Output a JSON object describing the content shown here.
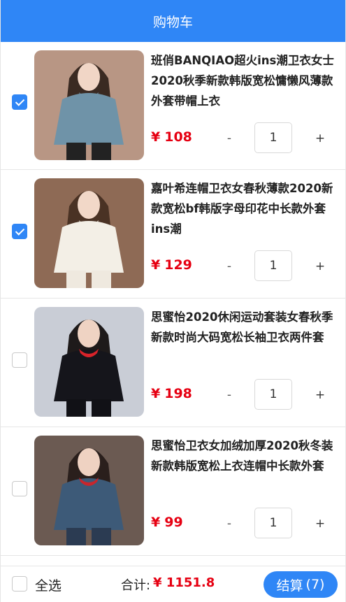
{
  "header": {
    "title": "购物车"
  },
  "currency_symbol": "¥",
  "items": [
    {
      "title": "班俏BANQIAO超火ins潮卫衣女士2020秋季新款韩版宽松慵懒风薄款外套带帽上衣",
      "price": "108",
      "qty": "1",
      "checked": true,
      "minus": "-",
      "plus": "+",
      "colors": {
        "bg": "#b89684",
        "cloth": "#6f93a8",
        "hair": "#3a2a22",
        "skin": "#f1d6c6",
        "pants": "#222222"
      }
    },
    {
      "title": "嘉叶希连帽卫衣女春秋薄款2020新款宽松bf韩版字母印花中长款外套ins潮",
      "price": "129",
      "qty": "1",
      "checked": true,
      "minus": "-",
      "plus": "+",
      "colors": {
        "bg": "#8e6a55",
        "cloth": "#f3efe6",
        "hair": "#4a3224",
        "skin": "#f2d8c8",
        "pants": "#efe9df"
      }
    },
    {
      "title": "思蜜怡2020休闲运动套装女春秋季新款时尚大码宽松长袖卫衣两件套",
      "price": "198",
      "qty": "1",
      "checked": false,
      "minus": "-",
      "plus": "+",
      "colors": {
        "bg": "#c9cdd6",
        "cloth": "#15151b",
        "hair": "#1e1a1a",
        "skin": "#efd3c3",
        "pants": "#111116",
        "accent": "#d8232a"
      }
    },
    {
      "title": "思蜜怡卫衣女加绒加厚2020秋冬装新款韩版宽松上衣连帽中长款外套",
      "price": "99",
      "qty": "1",
      "checked": false,
      "minus": "-",
      "plus": "+",
      "colors": {
        "bg": "#6b5a52",
        "cloth": "#3d5a78",
        "hair": "#2a1f1c",
        "skin": "#efd2c2",
        "pants": "#2b3b52",
        "accent": "#c8262c"
      }
    }
  ],
  "footer": {
    "select_all_label": "全选",
    "total_label": "合计:",
    "total_value": "¥ 1151.8",
    "checkout_label": "结算",
    "checkout_count": "(7)"
  },
  "theme": {
    "primary": "#2f86f6",
    "price": "#e60012"
  }
}
